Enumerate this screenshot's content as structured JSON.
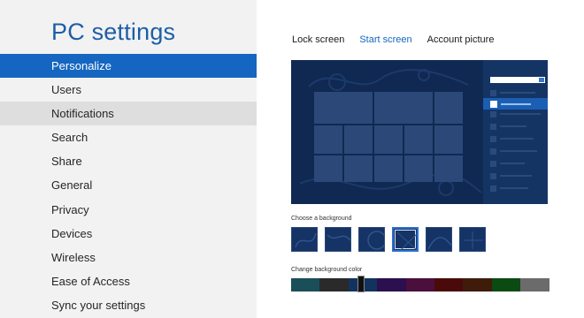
{
  "app": {
    "title": "PC settings"
  },
  "nav": {
    "items": [
      {
        "label": "Personalize",
        "state": "selected"
      },
      {
        "label": "Users",
        "state": ""
      },
      {
        "label": "Notifications",
        "state": "hover"
      },
      {
        "label": "Search",
        "state": ""
      },
      {
        "label": "Share",
        "state": ""
      },
      {
        "label": "General",
        "state": ""
      },
      {
        "label": "Privacy",
        "state": ""
      },
      {
        "label": "Devices",
        "state": ""
      },
      {
        "label": "Wireless",
        "state": ""
      },
      {
        "label": "Ease of Access",
        "state": ""
      },
      {
        "label": "Sync your settings",
        "state": ""
      }
    ]
  },
  "tabs": [
    {
      "label": "Lock screen",
      "active": false
    },
    {
      "label": "Start screen",
      "active": true
    },
    {
      "label": "Account picture",
      "active": false
    }
  ],
  "background": {
    "label": "Choose a background",
    "selected_index": 3,
    "thumb_count": 6
  },
  "color": {
    "label": "Change background color",
    "swatches": [
      "#1a4f5a",
      "#2a2a2a",
      "#13335f",
      "#2b0f4f",
      "#4a0f3d",
      "#4a0a0a",
      "#3f1c0a",
      "#0b4a13",
      "#6b6b6b"
    ],
    "slider_value": 0.27
  },
  "colors": {
    "accent": "#1566c0",
    "preview_background": "#0f2952",
    "nav_selected": "#1566c0",
    "nav_hover": "#dedede"
  }
}
